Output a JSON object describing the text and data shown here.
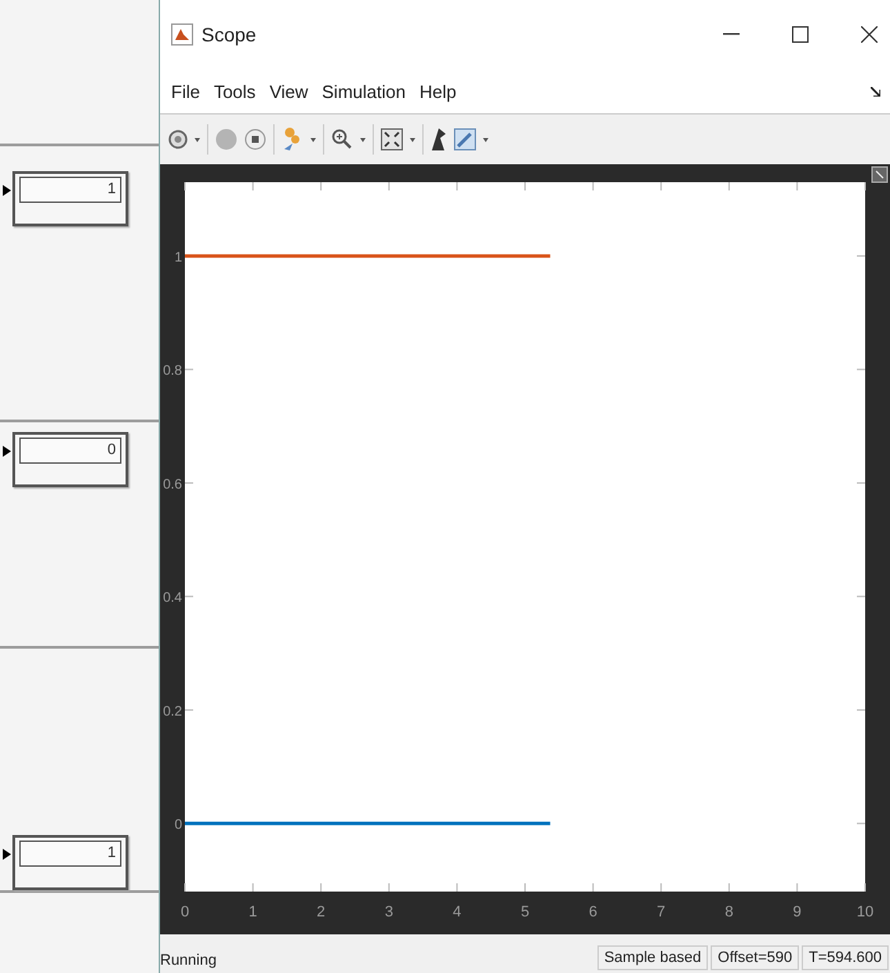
{
  "displays": [
    {
      "value": "1"
    },
    {
      "value": "0"
    },
    {
      "value": "1"
    }
  ],
  "window": {
    "title": "Scope"
  },
  "menu": [
    "File",
    "Tools",
    "View",
    "Simulation",
    "Help"
  ],
  "plot": {
    "chart_data": {
      "type": "line",
      "x": [
        0,
        5.37
      ],
      "series": [
        {
          "color": "#d95319",
          "values": [
            1,
            1
          ]
        },
        {
          "color": "#0072bd",
          "values": [
            0,
            0
          ]
        }
      ],
      "xlim": [
        0,
        10
      ],
      "ylim": [
        -0.12,
        1.13
      ],
      "xticks": [
        0,
        1,
        2,
        3,
        4,
        5,
        6,
        7,
        8,
        9,
        10
      ],
      "yticks": [
        0,
        0.2,
        0.4,
        0.6,
        0.8,
        1
      ]
    }
  },
  "status_bar": {
    "state": "Running",
    "panels": [
      "Sample based",
      "Offset=590",
      "T=594.600"
    ]
  }
}
